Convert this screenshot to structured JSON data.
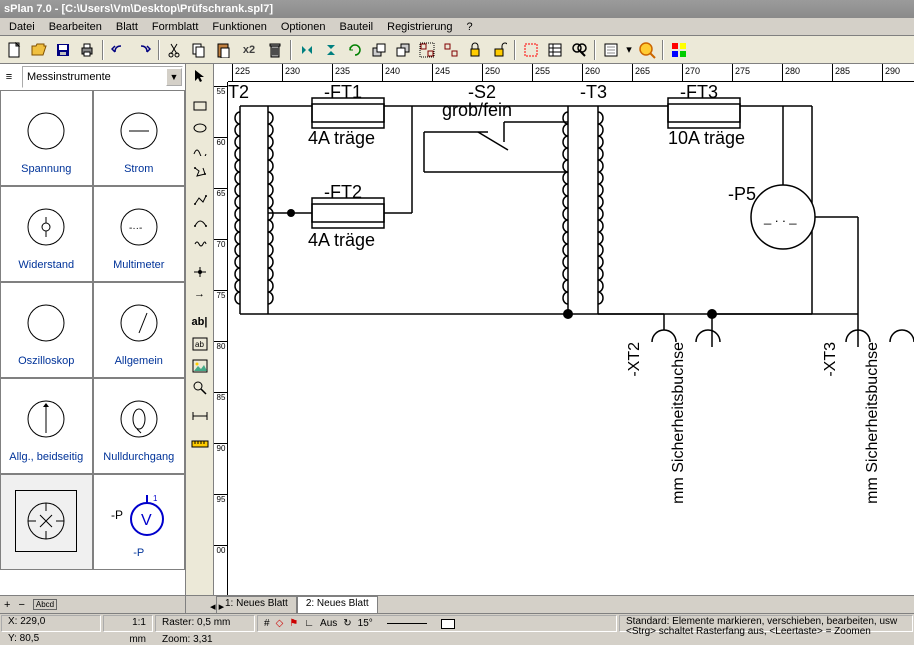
{
  "app": {
    "title": "sPlan 7.0 - [C:\\Users\\Vm\\Desktop\\Prüfschrank.spl7]"
  },
  "menu": [
    "Datei",
    "Bearbeiten",
    "Blatt",
    "Formblatt",
    "Funktionen",
    "Optionen",
    "Bauteil",
    "Registrierung",
    "?"
  ],
  "toolbar_x2": "x2",
  "library": {
    "category": "Messinstrumente",
    "items": [
      {
        "name": "Spannung"
      },
      {
        "name": "Strom"
      },
      {
        "name": "Widerstand"
      },
      {
        "name": "Multimeter"
      },
      {
        "name": "Oszilloskop"
      },
      {
        "name": "Allgemein"
      },
      {
        "name": "Allg., beidseitig"
      },
      {
        "name": "Nulldurchgang"
      },
      {
        "name": ""
      },
      {
        "name": "-P"
      }
    ]
  },
  "hruler_ticks": [
    225,
    230,
    235,
    240,
    245,
    250,
    255,
    260,
    265,
    270,
    275,
    280,
    285,
    290
  ],
  "vruler_ticks": [
    55,
    60,
    65,
    70,
    75,
    80,
    85,
    90,
    95,
    "00"
  ],
  "schematic": {
    "t2": "T2",
    "ft1": "-FT1",
    "ft1_rating": "4A träge",
    "ft2": "-FT2",
    "ft2_rating": "4A träge",
    "s2": "-S2",
    "s2_sub": "grob/fein",
    "t3": "-T3",
    "ft3": "-FT3",
    "ft3_rating": "10A träge",
    "p5": "-P5",
    "xt2": "-XT2",
    "xt2_sub": "mm Sicherheitsbuchse",
    "xt3": "-XT3",
    "xt3_sub": "mm Sicherheitsbuchse"
  },
  "sheets": [
    "1: Neues Blatt",
    "2: Neues Blatt"
  ],
  "status": {
    "coord_x": "X: 229,0",
    "coord_y": "Y: 80,5",
    "scale": "1:1",
    "unit": "mm",
    "raster": "Raster: 0,5 mm",
    "zoom": "Zoom:   3,31",
    "snap_off": "Aus",
    "angle": "15°",
    "help": "Standard: Elemente markieren, verschieben, bearbeiten, usw\n<Strg> schaltet Rasterfang aus, <Leertaste> = Zoomen"
  }
}
